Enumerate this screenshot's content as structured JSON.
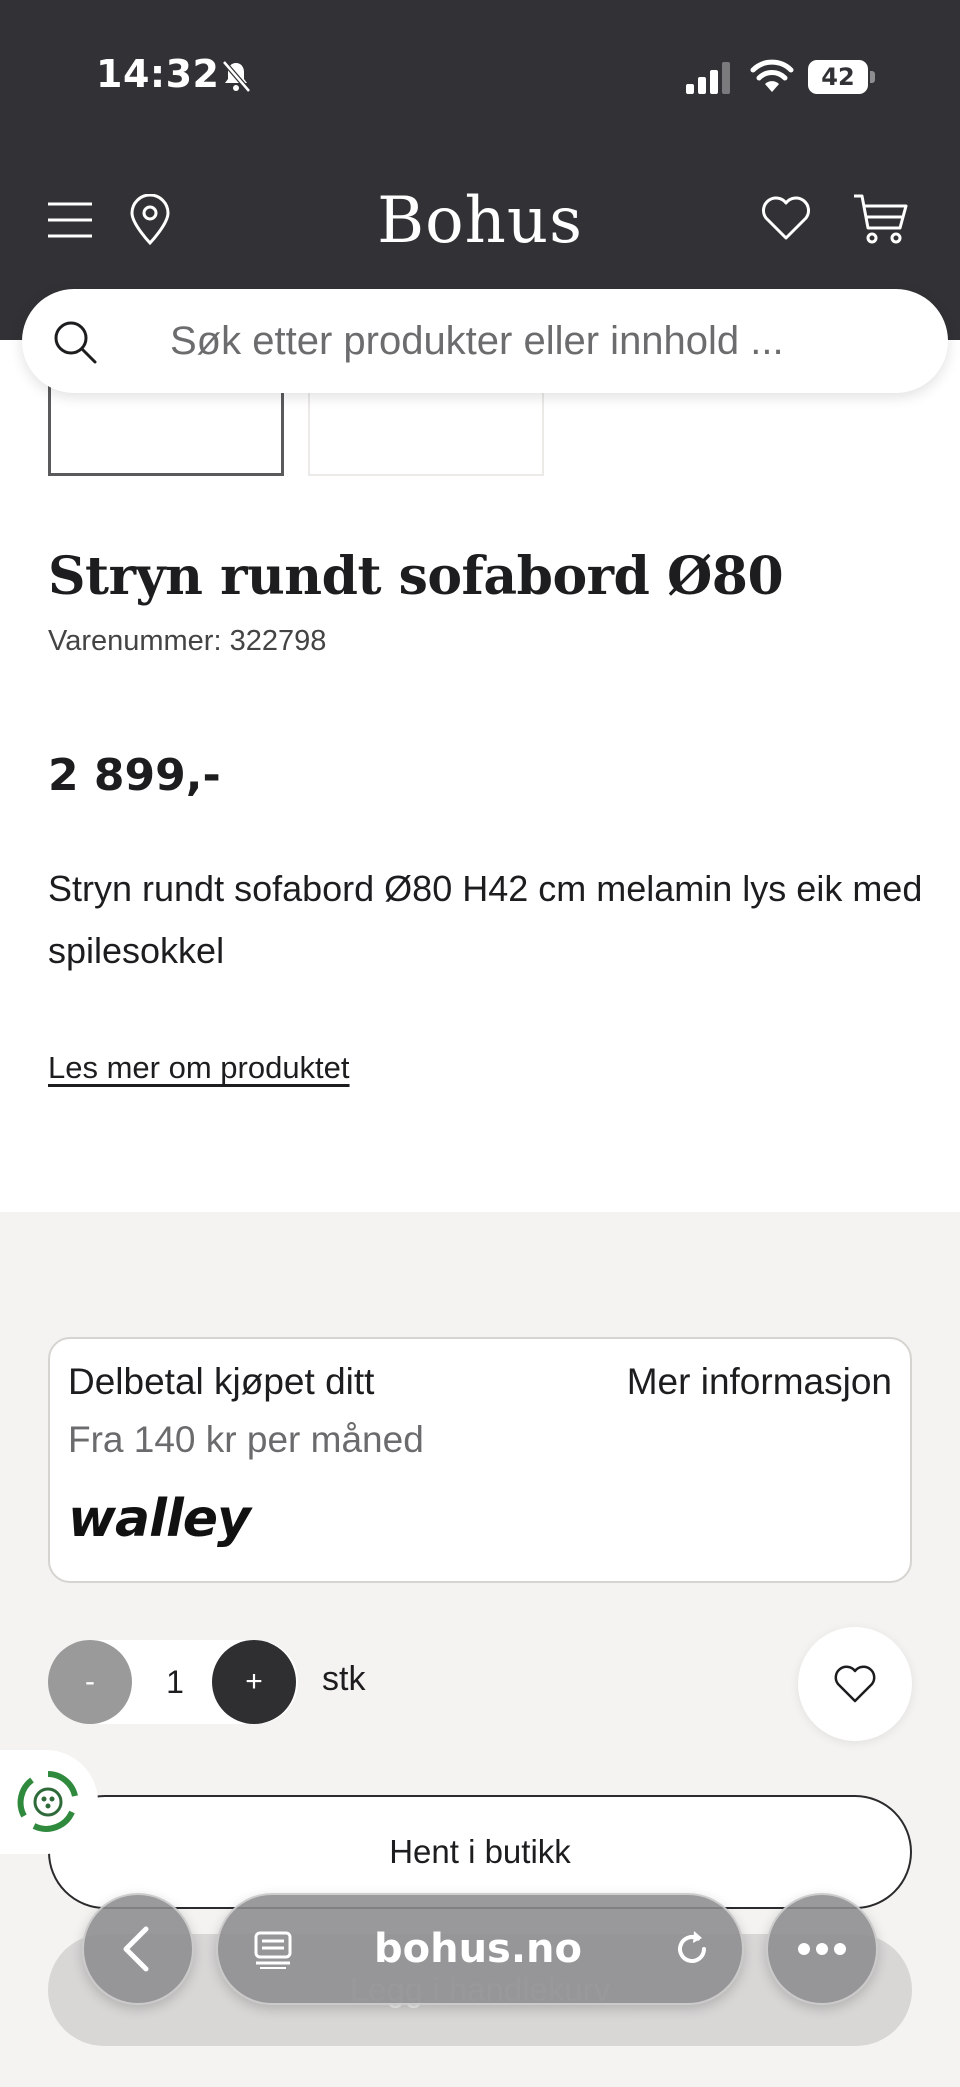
{
  "status_bar": {
    "time": "14:32",
    "battery": "42"
  },
  "header": {
    "brand": "Bohus"
  },
  "search": {
    "placeholder": "Søk etter produkter eller innhold ..."
  },
  "product": {
    "title": "Stryn rundt sofabord Ø80",
    "sku": "Varenummer: 322798",
    "price": "2 899,-",
    "description": "Stryn rundt sofabord Ø80 H42 cm melamin lys eik med spilesokkel",
    "read_more": "Les mer om produktet",
    "thumbnails": [
      "light oak",
      "dark"
    ]
  },
  "installment": {
    "title": "Delbetal kjøpet ditt",
    "more_info": "Mer informasjon",
    "subtitle": "Fra 140 kr per måned",
    "provider_logo": "walley"
  },
  "quantity": {
    "minus": "-",
    "value": "1",
    "plus": "+",
    "unit": "stk"
  },
  "actions": {
    "pickup": "Hent i butikk",
    "add_to_cart": "Legg i handlekurv"
  },
  "browser": {
    "url": "bohus.no"
  },
  "icons": {
    "menu": "menu-icon",
    "location": "location-pin-icon",
    "wishlist": "heart-icon",
    "cart": "cart-icon",
    "search": "search-icon",
    "eco": "recycle-icon"
  },
  "colors": {
    "header_bg": "#323135",
    "page_bg": "#f4f3f1",
    "accent_dark": "#2f2e31"
  }
}
